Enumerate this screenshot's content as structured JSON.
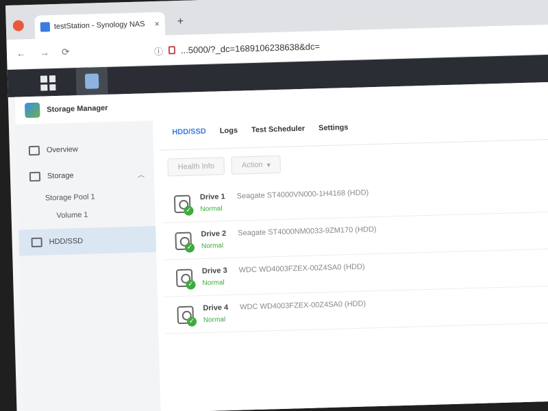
{
  "browser": {
    "tab_title": "testStation - Synology NAS",
    "tab_close": "×",
    "new_tab": "+",
    "url": "...5000/?_dc=1689106238638&dc="
  },
  "window": {
    "title": "Storage Manager"
  },
  "sidebar": {
    "overview": "Overview",
    "storage": "Storage",
    "storage_pool": "Storage Pool 1",
    "volume": "Volume 1",
    "hdd_ssd": "HDD/SSD"
  },
  "tabs": [
    "HDD/SSD",
    "Logs",
    "Test Scheduler",
    "Settings"
  ],
  "actions": {
    "health_info": "Health Info",
    "action": "Action"
  },
  "drives": [
    {
      "name": "Drive 1",
      "model": "Seagate ST4000VN000-1H4168 (HDD)",
      "status": "Normal"
    },
    {
      "name": "Drive 2",
      "model": "Seagate ST4000NM0033-9ZM170 (HDD)",
      "status": "Normal"
    },
    {
      "name": "Drive 3",
      "model": "WDC WD4003FZEX-00Z4SA0 (HDD)",
      "status": "Normal"
    },
    {
      "name": "Drive 4",
      "model": "WDC WD4003FZEX-00Z4SA0 (HDD)",
      "status": "Normal"
    }
  ],
  "icons": {
    "status_ok": "check-icon",
    "disk": "hdd-icon"
  },
  "colors": {
    "accent": "#3a7be0",
    "ok": "#3faa3f"
  }
}
